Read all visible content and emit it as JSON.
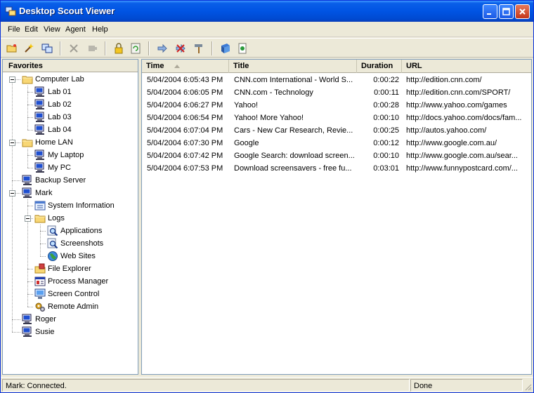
{
  "window": {
    "title": "Desktop Scout Viewer"
  },
  "menu": [
    "File",
    "Edit",
    "View",
    "Agent",
    "Help"
  ],
  "toolbar": [
    {
      "name": "open-folder-icon"
    },
    {
      "name": "wand-icon"
    },
    {
      "name": "connect-icon"
    },
    {
      "name": "delete-icon"
    },
    {
      "name": "plug-icon"
    },
    {
      "name": "lock-icon"
    },
    {
      "name": "refresh-icon"
    },
    {
      "name": "forward-icon"
    },
    {
      "name": "disconnect-icon"
    },
    {
      "name": "hammer-icon"
    },
    {
      "name": "book-icon"
    },
    {
      "name": "page-icon"
    }
  ],
  "favorites": {
    "header": "Favorites",
    "tree": [
      {
        "label": "Computer Lab",
        "icon": "folder-icon"
      },
      {
        "label": "Lab 01",
        "icon": "computer-icon"
      },
      {
        "label": "Lab 02",
        "icon": "computer-icon"
      },
      {
        "label": "Lab 03",
        "icon": "computer-icon"
      },
      {
        "label": "Lab 04",
        "icon": "computer-icon"
      },
      {
        "label": "Home LAN",
        "icon": "folder-icon"
      },
      {
        "label": "My Laptop",
        "icon": "computer-icon"
      },
      {
        "label": "My PC",
        "icon": "computer-icon"
      },
      {
        "label": "Backup Server",
        "icon": "computer-icon"
      },
      {
        "label": "Mark",
        "icon": "computer-icon"
      },
      {
        "label": "System Information",
        "icon": "info-icon"
      },
      {
        "label": "Logs",
        "icon": "folder-icon"
      },
      {
        "label": "Applications",
        "icon": "magnifier-icon"
      },
      {
        "label": "Screenshots",
        "icon": "magnifier-icon"
      },
      {
        "label": "Web Sites",
        "icon": "globe-icon"
      },
      {
        "label": "File Explorer",
        "icon": "file-explorer-icon"
      },
      {
        "label": "Process Manager",
        "icon": "process-icon"
      },
      {
        "label": "Screen Control",
        "icon": "monitor-icon"
      },
      {
        "label": "Remote Admin",
        "icon": "gears-icon"
      },
      {
        "label": "Roger",
        "icon": "computer-icon"
      },
      {
        "label": "Susie",
        "icon": "computer-icon"
      }
    ]
  },
  "table": {
    "columns": [
      "Time",
      "Title",
      "Duration",
      "URL"
    ],
    "rows": [
      [
        "5/04/2004 6:05:43 PM",
        "CNN.com International - World S...",
        "0:00:22",
        "http://edition.cnn.com/"
      ],
      [
        "5/04/2004 6:06:05 PM",
        "CNN.com - Technology",
        "0:00:11",
        "http://edition.cnn.com/SPORT/"
      ],
      [
        "5/04/2004 6:06:27 PM",
        "Yahoo!",
        "0:00:28",
        "http://www.yahoo.com/games"
      ],
      [
        "5/04/2004 6:06:54 PM",
        "Yahoo! More Yahoo!",
        "0:00:10",
        "http://docs.yahoo.com/docs/fam..."
      ],
      [
        "5/04/2004 6:07:04 PM",
        "Cars - New Car Research, Revie...",
        "0:00:25",
        "http://autos.yahoo.com/"
      ],
      [
        "5/04/2004 6:07:30 PM",
        "Google",
        "0:00:12",
        "http://www.google.com.au/"
      ],
      [
        "5/04/2004 6:07:42 PM",
        "Google Search: download screen...",
        "0:00:10",
        "http://www.google.com.au/sear..."
      ],
      [
        "5/04/2004 6:07:53 PM",
        "Download screensavers - free fu...",
        "0:03:01",
        "http://www.funnypostcard.com/..."
      ]
    ]
  },
  "status": {
    "left": "Mark: Connected.",
    "right": "Done"
  }
}
